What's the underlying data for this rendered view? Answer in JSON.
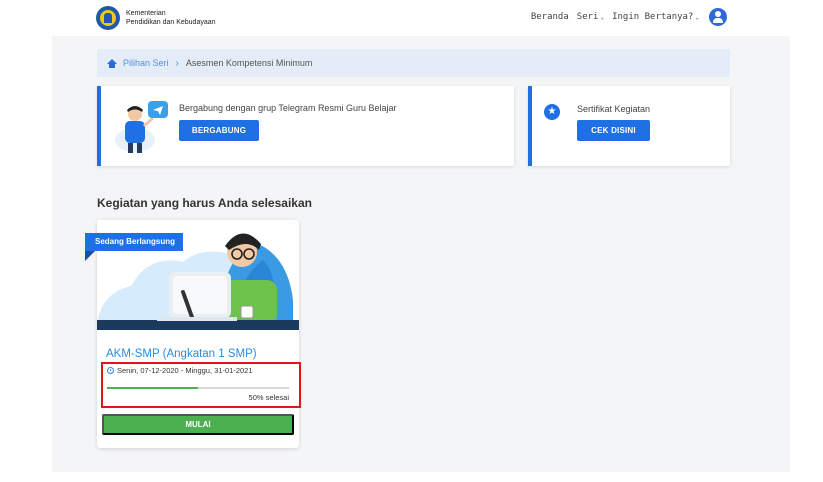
{
  "header": {
    "brand_line1": "Kementerian",
    "brand_line2": "Pendidikan dan Kebudayaan",
    "nav": {
      "beranda": "Beranda",
      "seri": "Seri",
      "ingin_bertanya": "Ingin Bertanya?"
    },
    "icons": {
      "logo": "tut-wuri-handayani-logo",
      "user": "user-account-icon",
      "chevron": "chevron-down-icon"
    }
  },
  "breadcrumb": {
    "home_label": "Pilihan Seri",
    "separator": "›",
    "current": "Asesmen Kompetensi Minimum"
  },
  "telegram_card": {
    "text": "Bergabung dengan grup Telegram Resmi Guru Belajar",
    "button": "BERGABUNG",
    "icon": "telegram-illustration"
  },
  "sertifikat_card": {
    "text": "Sertifikat Kegiatan",
    "button": "CEK DISINI",
    "icon": "star-badge-icon"
  },
  "section": {
    "title": "Kegiatan yang harus Anda selesaikan"
  },
  "activity": {
    "status": "Sedang Berlangsung",
    "title": "AKM-SMP  (Angkatan 1 SMP)",
    "dates": "Senin, 07-12-2020 - Minggu, 31-01-2021",
    "progress_percent": 50,
    "progress_label": "50% selesai",
    "button": "MULAI"
  },
  "colors": {
    "primary": "#1f6fe5",
    "success": "#4caf50",
    "highlight": "#e0141b",
    "breadcrumb_bg": "#e3ecf7"
  }
}
